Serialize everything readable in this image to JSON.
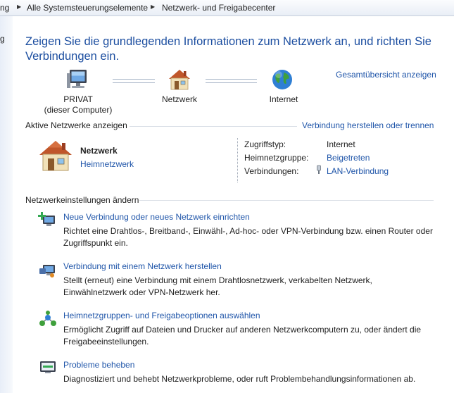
{
  "breadcrumb": {
    "items": [
      "ng",
      "Alle Systemsteuerungselemente",
      "Netzwerk- und Freigabecenter"
    ]
  },
  "sidebar": {
    "partial_text": "g"
  },
  "header": {
    "title": "Zeigen Sie die grundlegenden Informationen zum Netzwerk an, und richten Sie Verbindungen ein.",
    "overview_link": "Gesamtübersicht anzeigen"
  },
  "map": {
    "computer_label": "PRIVAT",
    "computer_sublabel": "(dieser Computer)",
    "network_label": "Netzwerk",
    "internet_label": "Internet"
  },
  "active": {
    "section_label": "Aktive Netzwerke anzeigen",
    "connect_link": "Verbindung herstellen oder trennen",
    "network_name": "Netzwerk",
    "network_type": "Heimnetzwerk",
    "access_type_label": "Zugriffstyp:",
    "access_type_value": "Internet",
    "homegroup_label": "Heimnetzgruppe:",
    "homegroup_value": "Beigetreten",
    "connections_label": "Verbindungen:",
    "connections_value": "LAN-Verbindung"
  },
  "settings": {
    "section_label": "Netzwerkeinstellungen ändern",
    "items": [
      {
        "title": "Neue Verbindung oder neues Netzwerk einrichten",
        "desc": "Richtet eine Drahtlos-, Breitband-, Einwähl-, Ad-hoc- oder VPN-Verbindung bzw. einen Router oder Zugriffspunkt ein."
      },
      {
        "title": "Verbindung mit einem Netzwerk herstellen",
        "desc": "Stellt (erneut) eine Verbindung mit einem Drahtlosnetzwerk, verkabelten Netzwerk, Einwählnetzwerk oder VPN-Netzwerk her."
      },
      {
        "title": "Heimnetzgruppen- und Freigabeoptionen auswählen",
        "desc": "Ermöglicht Zugriff auf Dateien und Drucker auf anderen Netzwerkcomputern zu, oder ändert die Freigabeeinstellungen."
      },
      {
        "title": "Probleme beheben",
        "desc": "Diagnostiziert und behebt Netzwerkprobleme, oder ruft Problembehandlungsinformationen ab."
      }
    ]
  },
  "colors": {
    "link": "#1f55a9",
    "title": "#1c4ea0",
    "text": "#1e1e1e"
  }
}
